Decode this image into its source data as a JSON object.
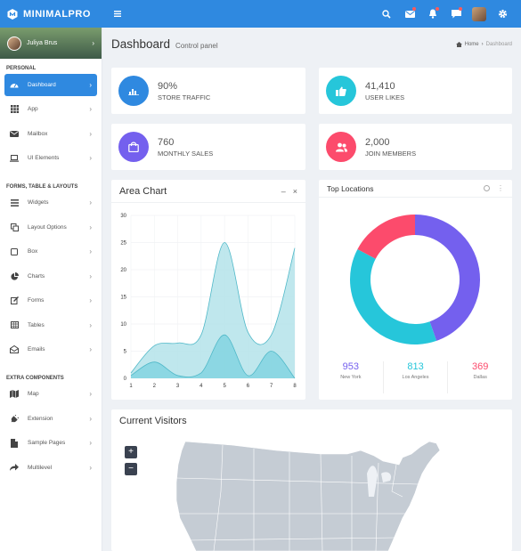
{
  "brand": {
    "name": "MINIMALPRO",
    "accent": "#2f89e0"
  },
  "header": {
    "icons": [
      "menu-icon",
      "search-icon",
      "mail-icon",
      "bell-icon",
      "chat-icon",
      "avatar",
      "gear-icon"
    ]
  },
  "user": {
    "name": "Juliya Brus"
  },
  "sidebar": {
    "sections": [
      {
        "title": "PERSONAL",
        "items": [
          {
            "label": "Dashboard",
            "icon": "dashboard-icon",
            "active": true
          },
          {
            "label": "App",
            "icon": "grid-icon"
          },
          {
            "label": "Mailbox",
            "icon": "mail-icon"
          },
          {
            "label": "UI Elements",
            "icon": "laptop-icon"
          }
        ]
      },
      {
        "title": "FORMS, TABLE & LAYOUTS",
        "items": [
          {
            "label": "Widgets",
            "icon": "list-icon"
          },
          {
            "label": "Layout Options",
            "icon": "copy-icon"
          },
          {
            "label": "Box",
            "icon": "square-icon"
          },
          {
            "label": "Charts",
            "icon": "pie-icon"
          },
          {
            "label": "Forms",
            "icon": "edit-icon"
          },
          {
            "label": "Tables",
            "icon": "table-icon"
          },
          {
            "label": "Emails",
            "icon": "envelope-open-icon"
          }
        ]
      },
      {
        "title": "EXTRA COMPONENTS",
        "items": [
          {
            "label": "Map",
            "icon": "map-icon"
          },
          {
            "label": "Extension",
            "icon": "plug-icon"
          },
          {
            "label": "Sample Pages",
            "icon": "file-icon"
          },
          {
            "label": "Multilevel",
            "icon": "share-icon"
          }
        ]
      }
    ]
  },
  "page": {
    "title": "Dashboard",
    "subtitle": "Control panel",
    "breadcrumb": {
      "home": "Home",
      "current": "Dashboard"
    }
  },
  "stats": [
    {
      "value": "90%",
      "label": "STORE TRAFFIC",
      "color": "#2f89e0",
      "icon": "bar-chart-icon"
    },
    {
      "value": "41,410",
      "label": "USER LIKES",
      "color": "#26c6da",
      "icon": "thumbs-up-icon"
    },
    {
      "value": "760",
      "label": "MONTHLY SALES",
      "color": "#7460ee",
      "icon": "shopping-bag-icon"
    },
    {
      "value": "2,000",
      "label": "JOIN MEMBERS",
      "color": "#fc4b6c",
      "icon": "users-icon"
    }
  ],
  "area_card": {
    "title": "Area Chart",
    "minimize": "–",
    "close": "×"
  },
  "donut_card": {
    "title": "Top Locations",
    "stats": [
      {
        "value": "953",
        "label": "New York",
        "color": "#7460ee"
      },
      {
        "value": "813",
        "label": "Los Angeles",
        "color": "#26c6da"
      },
      {
        "value": "369",
        "label": "Dallas",
        "color": "#fc4b6c"
      }
    ]
  },
  "visitors_card": {
    "title": "Current Visitors",
    "zoom_in": "+",
    "zoom_out": "−"
  },
  "chart_data": [
    {
      "type": "area",
      "x": [
        1,
        2,
        3,
        4,
        5,
        6,
        7,
        8
      ],
      "series": [
        {
          "values": [
            1,
            6,
            6.5,
            8,
            25,
            8.5,
            8,
            24
          ],
          "color": "#b4e3ea"
        },
        {
          "values": [
            0.5,
            3,
            0.5,
            1,
            8,
            0.5,
            5,
            0
          ],
          "color": "#7fd3e0"
        }
      ],
      "xlim": [
        1,
        8
      ],
      "ylim": [
        0,
        30
      ],
      "yticks": [
        0,
        5,
        10,
        15,
        20,
        25,
        30
      ],
      "grid": true
    },
    {
      "type": "pie",
      "categories": [
        "New York",
        "Los Angeles",
        "Dallas"
      ],
      "values": [
        953,
        813,
        369
      ],
      "colors": [
        "#7460ee",
        "#26c6da",
        "#fc4b6c"
      ],
      "donut": true
    }
  ]
}
